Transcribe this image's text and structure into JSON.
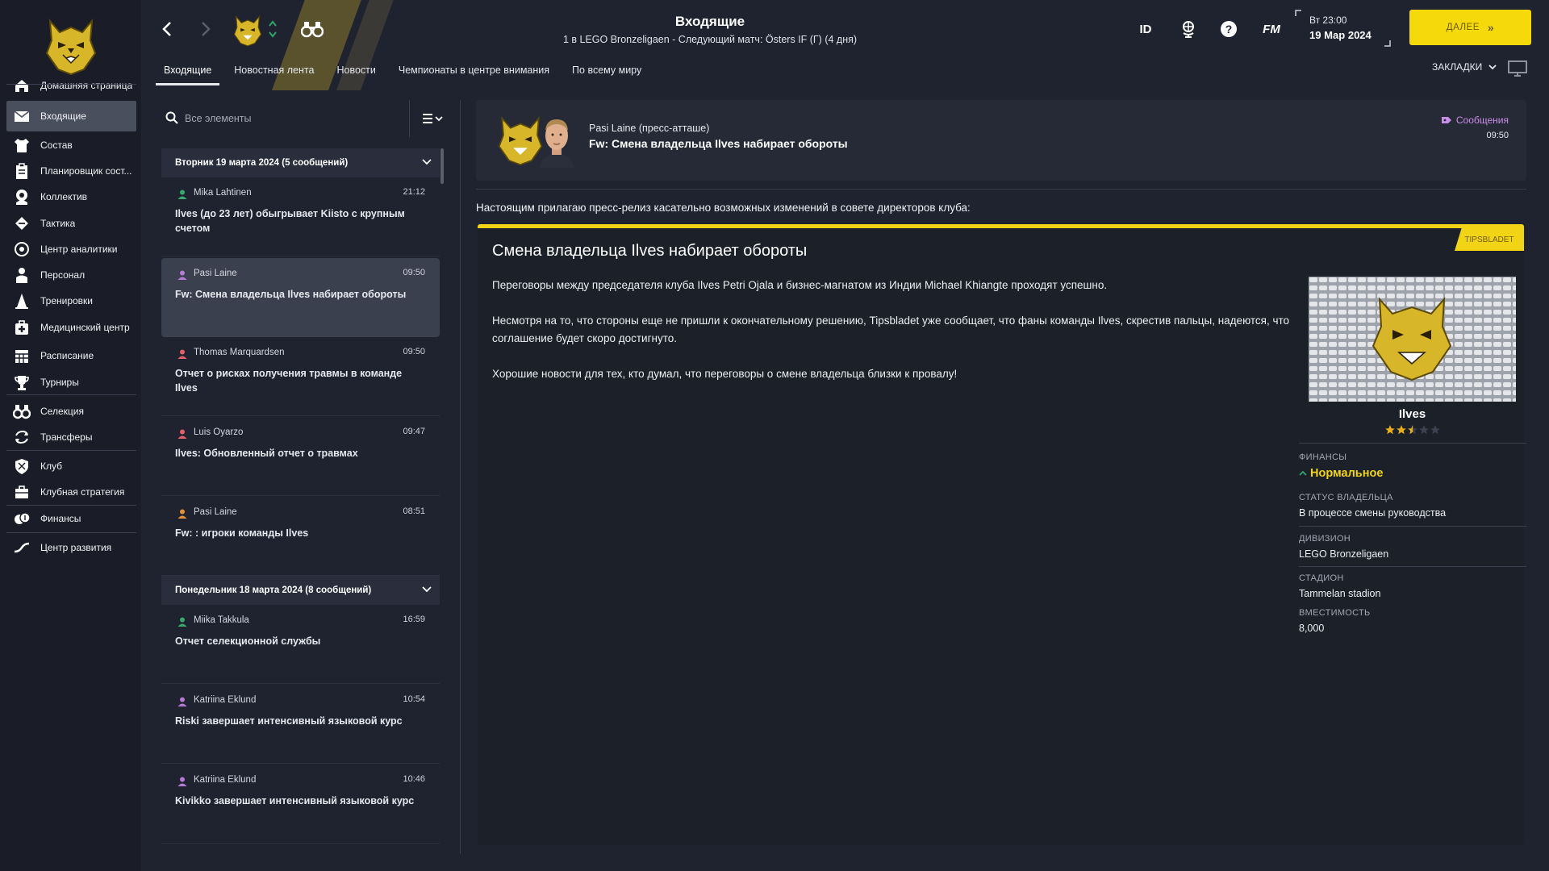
{
  "header": {
    "title": "Входящие",
    "subtitle": "1 в LEGO Bronzeligaen - Следующий матч: Östers IF (Г) (4 дня)",
    "id_label": "ID",
    "fm_label": "FM",
    "clock_time": "Вт 23:00",
    "clock_date": "19 Мар 2024",
    "continue_label": "ДАЛЕЕ",
    "bookmarks_label": "ЗАКЛАДКИ",
    "tabs": [
      {
        "label": "Входящие"
      },
      {
        "label": "Новостная лента"
      },
      {
        "label": "Новости"
      },
      {
        "label": "Чемпионаты в центре внимания"
      },
      {
        "label": "По всему миру"
      }
    ]
  },
  "sidebar": {
    "items": [
      {
        "label": "Домашняя страница",
        "icon": "home-icon"
      },
      {
        "label": "Входящие",
        "icon": "mail-icon"
      },
      {
        "label": "Состав",
        "icon": "shirt-icon"
      },
      {
        "label": "Планировщик сост...",
        "icon": "clipboard-icon"
      },
      {
        "label": "Коллектив",
        "icon": "team-icon"
      },
      {
        "label": "Тактика",
        "icon": "tactics-icon"
      },
      {
        "label": "Центр аналитики",
        "icon": "analytics-icon"
      },
      {
        "label": "Персонал",
        "icon": "staff-icon"
      },
      {
        "label": "Тренировки",
        "icon": "cone-icon"
      },
      {
        "label": "Медицинский центр",
        "icon": "medical-icon"
      },
      {
        "label": "Расписание",
        "icon": "calendar-icon"
      },
      {
        "label": "Турниры",
        "icon": "trophy-icon"
      },
      {
        "label": "Селекция",
        "icon": "binoculars-icon"
      },
      {
        "label": "Трансферы",
        "icon": "transfer-icon"
      },
      {
        "label": "Клуб",
        "icon": "shield-icon"
      },
      {
        "label": "Клубная стратегия",
        "icon": "briefcase-icon"
      },
      {
        "label": "Финансы",
        "icon": "money-icon"
      },
      {
        "label": "Центр развития",
        "icon": "development-icon"
      }
    ]
  },
  "inbox": {
    "search_placeholder": "Все элементы",
    "days": [
      {
        "label": "Вторник 19 марта 2024 (5 сообщений)"
      },
      {
        "label": "Понедельник 18 марта 2024 (8 сообщений)"
      }
    ],
    "messages": [
      {
        "from": "Mika Lahtinen",
        "time": "21:12",
        "subject": "Ilves (до 23 лет) обыгрывает Kiisto с крупным счетом",
        "color": "#3aa76d"
      },
      {
        "from": "Pasi Laine",
        "time": "09:50",
        "subject": "Fw: Смена владельца Ilves набирает обороты",
        "color": "#b57ad6"
      },
      {
        "from": "Thomas Marquardsen",
        "time": "09:50",
        "subject": "Отчет о рисках получения травмы в команде Ilves",
        "color": "#e0606a"
      },
      {
        "from": "Luis Oyarzo",
        "time": "09:47",
        "subject": "Ilves: Обновленный отчет о травмах",
        "color": "#e0606a"
      },
      {
        "from": "Pasi Laine",
        "time": "08:51",
        "subject": "Fw: : игроки команды Ilves",
        "color": "#e0913a"
      },
      {
        "from": "Miika Takkula",
        "time": "16:59",
        "subject": "Отчет селекционной службы",
        "color": "#3aa76d"
      },
      {
        "from": "Katriina Eklund",
        "time": "10:54",
        "subject": "Riski завершает интенсивный языковой курс",
        "color": "#b57ad6"
      },
      {
        "from": "Katriina Eklund",
        "time": "10:46",
        "subject": "Kivikko завершает интенсивный языковой курс",
        "color": "#b57ad6"
      }
    ]
  },
  "message": {
    "sender": "Pasi Laine  (пресс-атташе)",
    "subject": "Fw: Смена владельца Ilves набирает обороты",
    "tag": "Сообщения",
    "time": "09:50",
    "intro": "Настоящим прилагаю пресс-релиз касательно возможных изменений в совете директоров клуба:",
    "source": "TIPSBLADET",
    "article_title": "Смена владельца Ilves набирает обороты",
    "paragraphs": [
      "Переговоры между председателя клуба Ilves Petri Ojala и бизнес-магнатом из Индии Michael Khiangte проходят успешно.",
      "Несмотря на то, что стороны еще не пришли к окончательному решению, Tipsbladet уже сообщает, что фаны команды Ilves, скрестив пальцы, надеются, что соглашение будет скоро достигнуто.",
      "Хорошие новости для тех, кто думал, что переговоры о смене владельца близки к провалу!"
    ]
  },
  "club": {
    "name": "Ilves",
    "rating_stars": 2.5,
    "finance_label": "ФИНАНСЫ",
    "finance_value": "Нормальное",
    "owner_label": "СТАТУС ВЛАДЕЛЬЦА",
    "owner_value": "В процессе смены руководства",
    "division_label": "ДИВИЗИОН",
    "division_value": "LEGO Bronzeligaen",
    "stadium_label": "СТАДИОН",
    "stadium_value": "Tammelan stadion",
    "capacity_label": "ВМЕСТИМОСТЬ",
    "capacity_value": "8,000"
  },
  "colors": {
    "accent": "#f5d90a",
    "message_tag": "#c98ee6",
    "background": "#1f2330",
    "sidebar": "#1a1d28"
  }
}
